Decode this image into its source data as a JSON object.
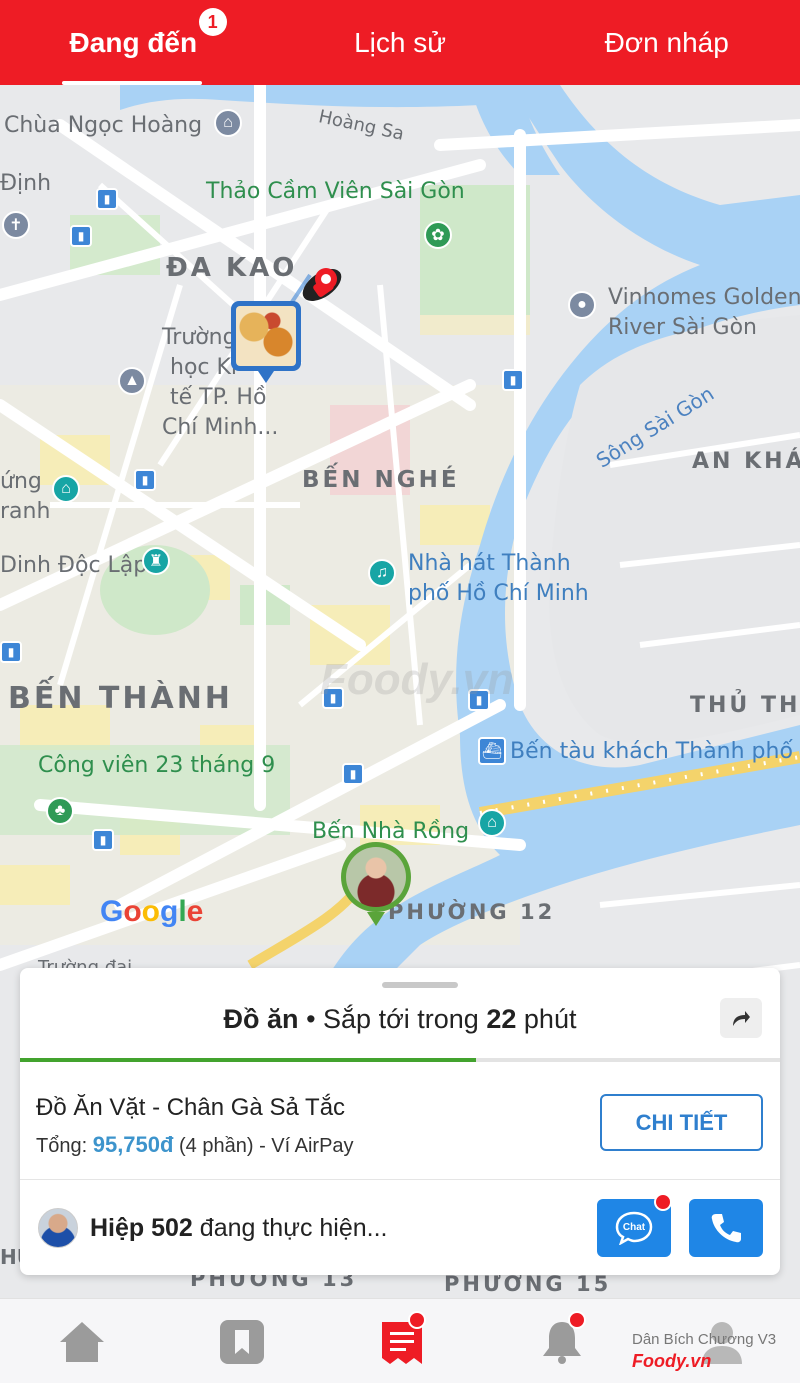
{
  "top_tabs": [
    {
      "label": "Đang đến",
      "badge": "1",
      "active": true
    },
    {
      "label": "Lịch sử",
      "active": false
    },
    {
      "label": "Đơn nháp",
      "active": false
    }
  ],
  "map": {
    "labels": {
      "chua_ngoc_hoang": "Chùa Ngọc Hoàng",
      "hoang_sa": "Hoàng Sa",
      "dinh": "Định",
      "thao_cam_vien": "Thảo Cầm Viên Sài Gòn",
      "da_kao": "ĐA KAO",
      "truong_1": "Trường",
      "truong_2": "học Ki",
      "truong_3": "tế TP. Hồ",
      "truong_4": "Chí Minh...",
      "vinhomes_1": "Vinhomes Golden",
      "vinhomes_2": "River Sài Gòn",
      "song_sai_gon": "Sông Sài Gòn",
      "an_kha": "AN KHÁ",
      "ung": "ứng",
      "anh": "ranh",
      "ben_nghe": "BẾN NGHÉ",
      "dinh_doc_lap": "Dinh Độc Lập",
      "nha_hat_1": "Nhà hát Thành",
      "nha_hat_2": "phố Hồ Chí Minh",
      "ben_thanh": "BẾN THÀNH",
      "thu_thi": "THỦ THI",
      "ben_tau": "Bến tàu khách Thành phố",
      "cong_vien": "Công viên 23 tháng 9",
      "ben_nha_rong": "Bến Nhà Rồng",
      "phuong_12": "PHƯỜNG 12",
      "truong_dai": "Trường đại",
      "phuong_15": "PHƯỜNG 15",
      "hu": "HU",
      "phuong_13": "PHƯỜNG 13"
    },
    "watermark": "Foody.vn",
    "attribution": [
      "G",
      "o",
      "o",
      "g",
      "l",
      "e"
    ]
  },
  "order_card": {
    "category": "Đồ ăn",
    "status_prefix": "Sắp tới trong",
    "eta_minutes": "22",
    "eta_unit": "phút",
    "progress": 0.6,
    "restaurant_name": "Đồ Ăn Vặt - Chân Gà Sả Tắc",
    "total_label": "Tổng:",
    "total_amount": "95,750đ",
    "total_suffix": "(4 phần) - Ví AirPay",
    "detail_button": "CHI TIẾT",
    "driver_name": "Hiệp 502",
    "driver_status": "đang thực hiện...",
    "chat_label": "Chat"
  },
  "bottom_nav": {
    "credit": "Dân Bích Chương",
    "credit_mark": "V3",
    "brand": "Foody.vn"
  },
  "colors": {
    "brand_red": "#ee1c25",
    "action_blue": "#1f86e6",
    "progress_green": "#43a32e",
    "price_blue": "#3d94cc"
  }
}
